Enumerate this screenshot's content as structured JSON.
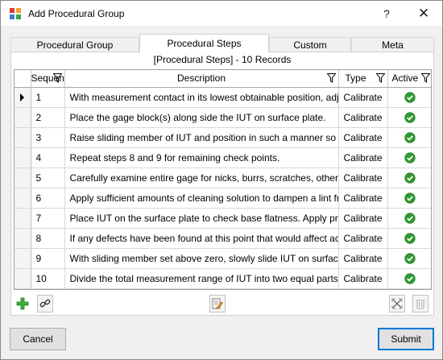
{
  "window": {
    "title": "Add Procedural Group",
    "help_glyph": "?",
    "close_glyph": "✕"
  },
  "tabs": [
    {
      "label": "Procedural Group",
      "active": false
    },
    {
      "label": "Procedural Steps",
      "active": true
    },
    {
      "label": "Custom",
      "active": false
    },
    {
      "label": "Meta",
      "active": false
    }
  ],
  "grid": {
    "caption": "[Procedural Steps] - 10 Records",
    "columns": [
      "Sequenc",
      "Description",
      "Type",
      "Active"
    ],
    "rows": [
      {
        "seq": "1",
        "description": "With measurement contact in its lowest obtainable position, adju",
        "type": "Calibrate",
        "active": true,
        "current": true
      },
      {
        "seq": "2",
        "description": "Place the gage block(s) along side the IUT on surface plate.",
        "type": "Calibrate",
        "active": true,
        "current": false
      },
      {
        "seq": "3",
        "description": "Raise sliding member of IUT and position in such a manner so as",
        "type": "Calibrate",
        "active": true,
        "current": false
      },
      {
        "seq": "4",
        "description": "Repeat steps 8 and 9 for remaining check points.",
        "type": "Calibrate",
        "active": true,
        "current": false
      },
      {
        "seq": "5",
        "description": "Carefully examine entire gage for nicks, burrs, scratches, other si",
        "type": "Calibrate",
        "active": true,
        "current": false
      },
      {
        "seq": "6",
        "description": "Apply sufficient amounts of cleaning solution to dampen a lint fre",
        "type": "Calibrate",
        "active": true,
        "current": false
      },
      {
        "seq": "7",
        "description": "Place IUT on the surface plate to check base flatness. Apply pres",
        "type": "Calibrate",
        "active": true,
        "current": false
      },
      {
        "seq": "8",
        "description": "If any defects have been found at this point that would affect acc",
        "type": "Calibrate",
        "active": true,
        "current": false
      },
      {
        "seq": "9",
        "description": "With sliding member set above zero, slowly slide IUT on surface",
        "type": "Calibrate",
        "active": true,
        "current": false
      },
      {
        "seq": "10",
        "description": "Divide the total measurement range of IUT into two equal parts.",
        "type": "Calibrate",
        "active": true,
        "current": false
      }
    ]
  },
  "toolbar_icons": [
    "add-icon",
    "link-icon",
    "edit-icon",
    "expand-icon",
    "delete-icon"
  ],
  "buttons": {
    "cancel": "Cancel",
    "submit": "Submit"
  },
  "colors": {
    "accent": "#0078d7",
    "check": "#2e9e2e"
  }
}
